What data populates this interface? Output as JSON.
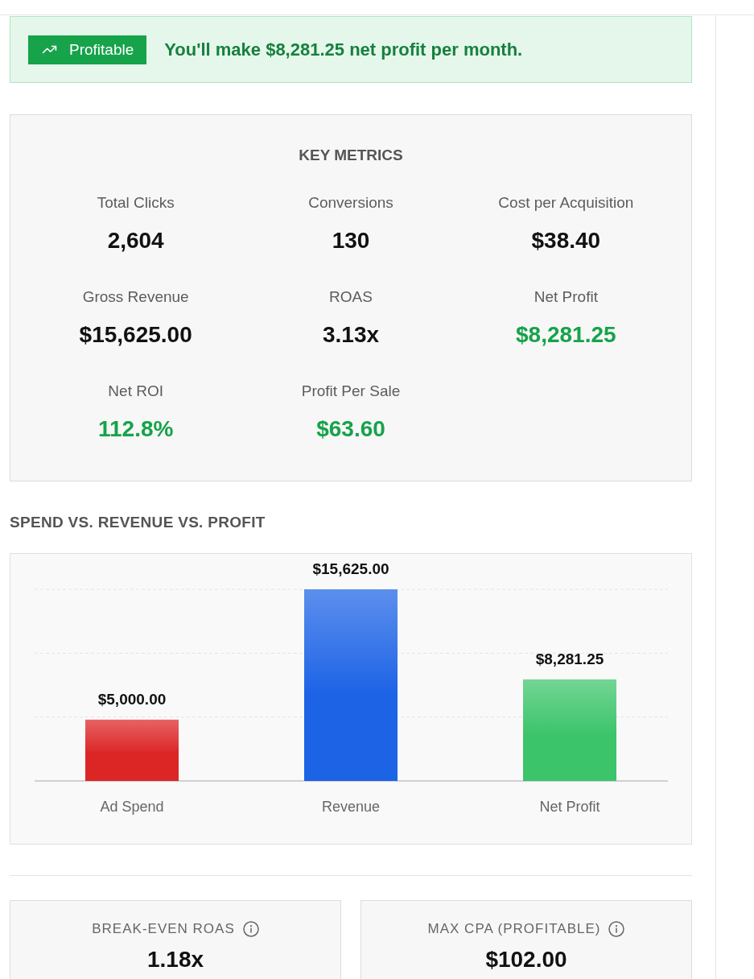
{
  "banner": {
    "status": {
      "label": "Profitable",
      "kind": "profitable"
    },
    "message": "You'll make $8,281.25 net profit per month."
  },
  "key_metrics": {
    "title": "KEY METRICS",
    "items": [
      {
        "label": "Total Clicks",
        "value": "2,604",
        "positive": false
      },
      {
        "label": "Conversions",
        "value": "130",
        "positive": false
      },
      {
        "label": "Cost per Acquisition",
        "value": "$38.40",
        "positive": false
      },
      {
        "label": "Gross Revenue",
        "value": "$15,625.00",
        "positive": false
      },
      {
        "label": "ROAS",
        "value": "3.13x",
        "positive": false
      },
      {
        "label": "Net Profit",
        "value": "$8,281.25",
        "positive": true
      },
      {
        "label": "Net ROI",
        "value": "112.8%",
        "positive": true
      },
      {
        "label": "Profit Per Sale",
        "value": "$63.60",
        "positive": true
      }
    ]
  },
  "chart_section": {
    "title": "SPEND VS. REVENUE VS. PROFIT",
    "chart_data": {
      "type": "bar",
      "categories": [
        "Ad Spend",
        "Revenue",
        "Net Profit"
      ],
      "series": [
        {
          "color": "#dc2626",
          "values": [
            5000,
            null,
            null
          ],
          "value_labels": [
            "$5,000.00",
            null,
            null
          ]
        },
        {
          "color": "#1d63e6",
          "values": [
            null,
            15625,
            null
          ],
          "value_labels": [
            null,
            "$15,625.00",
            null
          ]
        },
        {
          "color": "#3cc46a",
          "values": [
            null,
            null,
            8281.25
          ],
          "value_labels": [
            null,
            null,
            "$8,281.25"
          ]
        }
      ],
      "stacked": true,
      "ylim": [
        0,
        15625
      ],
      "yticks": [
        {
          "value": 5208.33,
          "label": null
        },
        {
          "value": 10416.67,
          "label": null
        },
        {
          "value": 15625,
          "label": null
        }
      ]
    }
  },
  "summary_cards": [
    {
      "title": "BREAK-EVEN ROAS",
      "info": true,
      "value": "1.18x"
    },
    {
      "title": "MAX CPA (PROFITABLE)",
      "info": true,
      "value": "$102.00"
    }
  ]
}
